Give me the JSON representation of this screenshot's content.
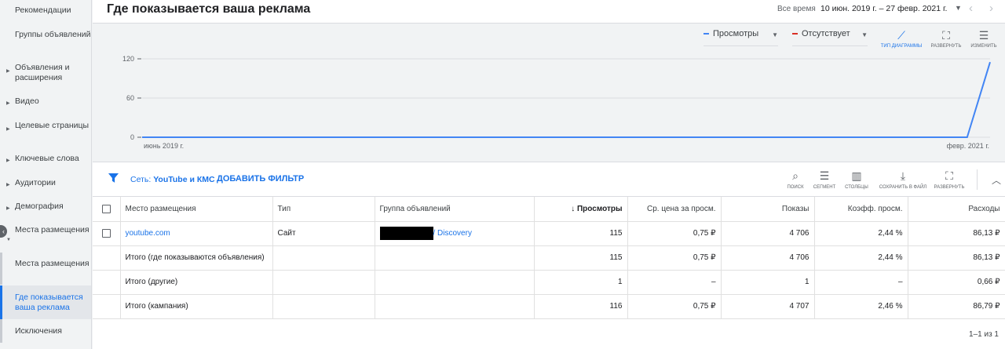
{
  "sidebar": {
    "items": [
      {
        "label": "Рекомендации"
      },
      {
        "label": "Группы объявлений"
      },
      {
        "label": "Объявления и расширения"
      },
      {
        "label": "Видео"
      },
      {
        "label": "Целевые страницы"
      },
      {
        "label": "Ключевые слова"
      },
      {
        "label": "Аудитории"
      },
      {
        "label": "Демография"
      },
      {
        "label": "Места размещения"
      },
      {
        "label": "Места размещения"
      },
      {
        "label": "Где показывается ваша реклама"
      },
      {
        "label": "Исключения"
      }
    ]
  },
  "header": {
    "title": "Где показывается ваша реклама",
    "range_label": "Все время",
    "range_value": "10 июн. 2019 г. – 27 февр. 2021 г."
  },
  "chart_toolbar": {
    "metric1": "Просмотры",
    "metric2": "Отсутствует",
    "chart_type": "ТИП ДИАГРАММЫ",
    "expand": "РАЗВЕРНУТЬ",
    "change": "ИЗМЕНИТЬ"
  },
  "chart_data": {
    "type": "line",
    "title": "",
    "xlabel": "",
    "ylabel": "",
    "x_tick_labels": [
      "июнь 2019 г.",
      "февр. 2021 г."
    ],
    "y_ticks": [
      0,
      60,
      120
    ],
    "ylim": [
      0,
      120
    ],
    "grid": true,
    "series": [
      {
        "name": "Просмотры",
        "color": "#4285f4",
        "points": [
          {
            "x": "2019-06-10",
            "y": 0
          },
          {
            "x": "2021-02-10",
            "y": 0
          },
          {
            "x": "2021-02-27",
            "y": 115
          }
        ]
      }
    ]
  },
  "filter_bar": {
    "chip_prefix": "Сеть: ",
    "chip_value": "YouTube и КМС",
    "add_filter": "ДОБАВИТЬ ФИЛЬТР",
    "tools": [
      "ПОИСК",
      "СЕГМЕНТ",
      "СТОЛБЦЫ",
      "СОХРАНИТЬ В ФАЙЛ",
      "РАЗВЕРНУТЬ"
    ]
  },
  "table": {
    "columns": [
      "Место размещения",
      "Тип",
      "Группа объявлений",
      "Просмотры",
      "Ср. цена за просм.",
      "Показы",
      "Коэфф. просм.",
      "Расходы"
    ],
    "sort_arrow": "↓",
    "rows": [
      [
        "youtube.com",
        "Сайт",
        "/ Discovery",
        "115",
        "0,75 ₽",
        "4 706",
        "2,44 %",
        "86,13 ₽"
      ],
      [
        "Итого (где показываются объявления)",
        "",
        "",
        "115",
        "0,75 ₽",
        "4 706",
        "2,44 %",
        "86,13 ₽"
      ],
      [
        "Итого (другие)",
        "",
        "",
        "1",
        "–",
        "1",
        "–",
        "0,66 ₽"
      ],
      [
        "Итого (кампания)",
        "",
        "",
        "116",
        "0,75 ₽",
        "4 707",
        "2,46 %",
        "86,79 ₽"
      ]
    ],
    "pagination": "1–1 из 1"
  },
  "colors": {
    "accent": "#1a73e8",
    "series1": "#4285f4",
    "series2": "#d93025"
  }
}
